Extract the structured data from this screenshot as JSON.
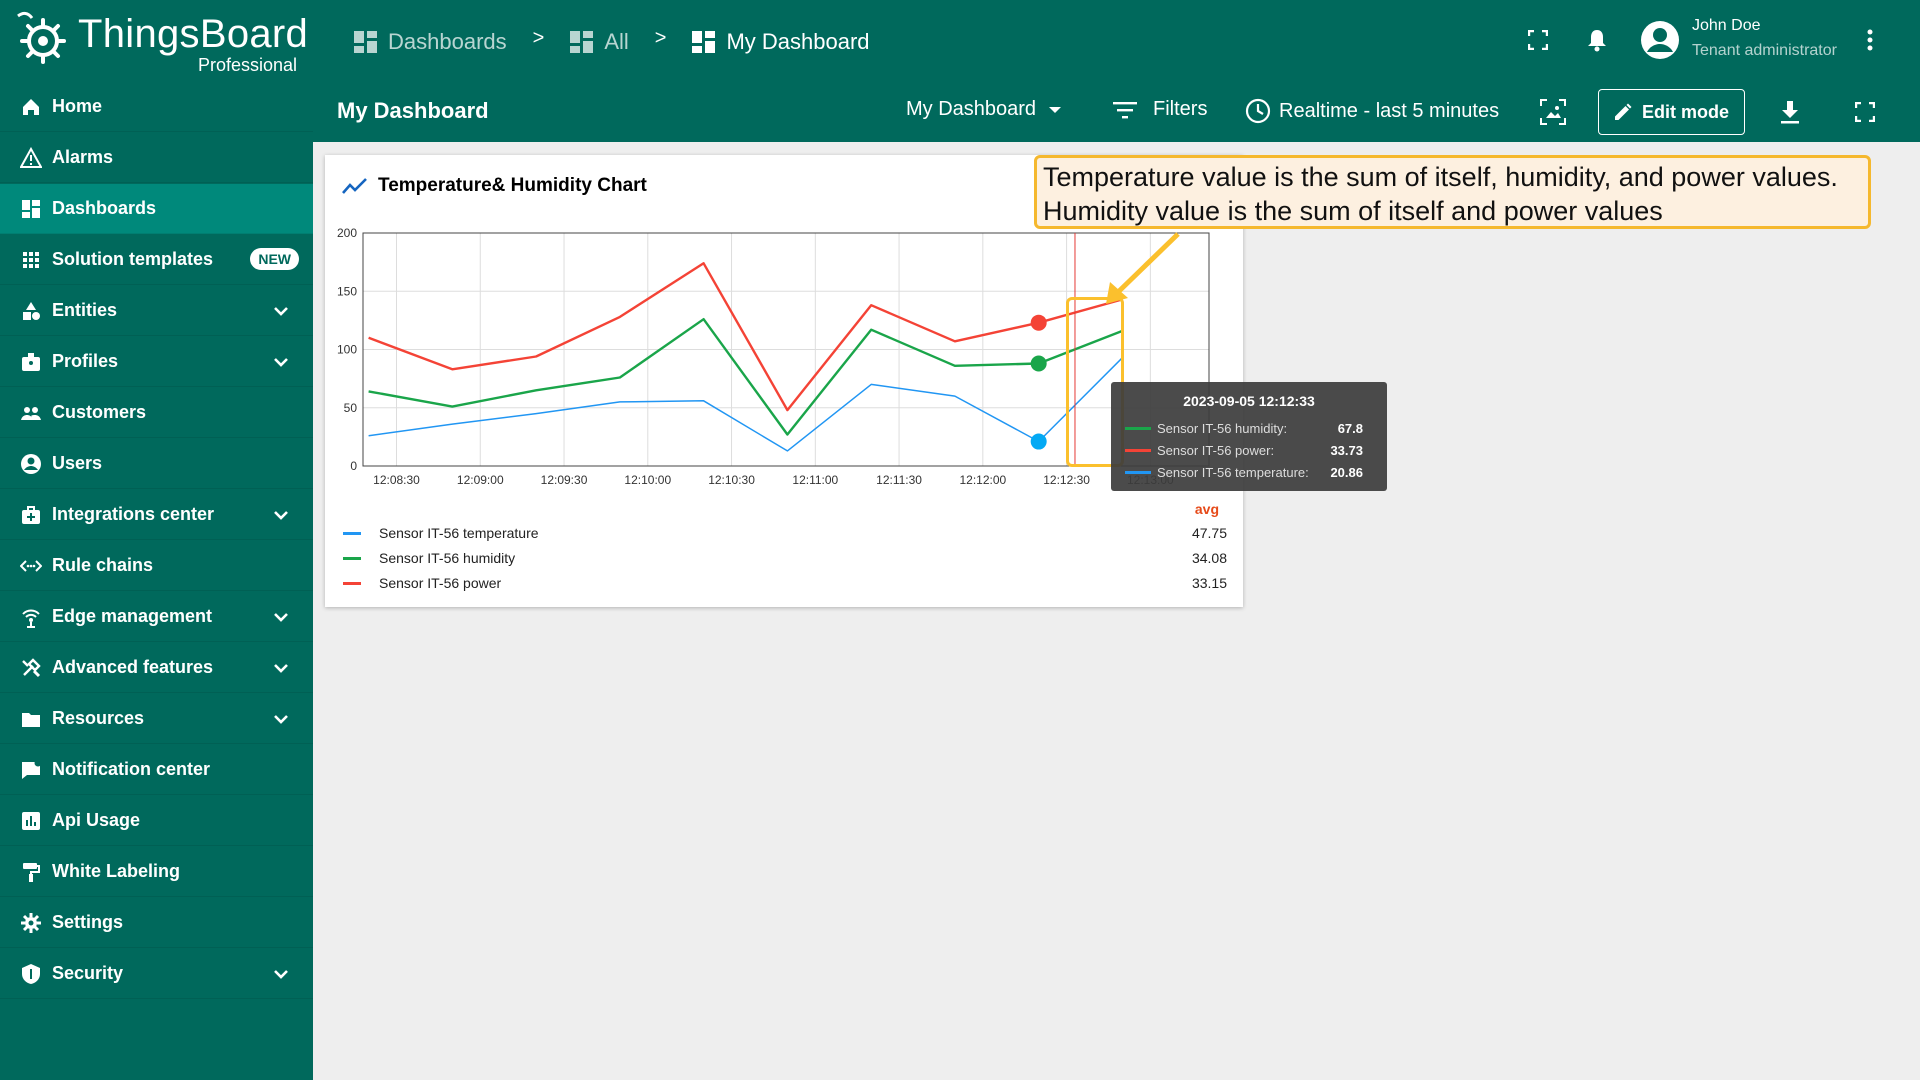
{
  "brand": {
    "name": "ThingsBoard",
    "edition": "Professional"
  },
  "breadcrumb": [
    {
      "label": "Dashboards",
      "icon": "dashboard-grid-icon"
    },
    {
      "label": "All",
      "icon": "dashboard-grid-icon"
    },
    {
      "label": "My Dashboard",
      "icon": "dashboard-grid-icon"
    }
  ],
  "breadcrumb_separator": ">",
  "user": {
    "name": "John Doe",
    "role": "Tenant administrator"
  },
  "sidebar": {
    "items": [
      {
        "label": "Home",
        "icon": "home-icon",
        "expandable": false
      },
      {
        "label": "Alarms",
        "icon": "warning-icon",
        "expandable": false
      },
      {
        "label": "Dashboards",
        "icon": "dashboard-icon",
        "expandable": false,
        "active": true
      },
      {
        "label": "Solution templates",
        "icon": "apps-icon",
        "expandable": false,
        "badge": "NEW"
      },
      {
        "label": "Entities",
        "icon": "category-icon",
        "expandable": true
      },
      {
        "label": "Profiles",
        "icon": "badge-icon",
        "expandable": true
      },
      {
        "label": "Customers",
        "icon": "people-icon",
        "expandable": false
      },
      {
        "label": "Users",
        "icon": "account-icon",
        "expandable": false
      },
      {
        "label": "Integrations center",
        "icon": "integration-icon",
        "expandable": true
      },
      {
        "label": "Rule chains",
        "icon": "settings-ethernet-icon",
        "expandable": false
      },
      {
        "label": "Edge management",
        "icon": "router-icon",
        "expandable": true
      },
      {
        "label": "Advanced features",
        "icon": "build-icon",
        "expandable": true
      },
      {
        "label": "Resources",
        "icon": "folder-icon",
        "expandable": true
      },
      {
        "label": "Notification center",
        "icon": "mark-chat-icon",
        "expandable": false
      },
      {
        "label": "Api Usage",
        "icon": "insert-chart-icon",
        "expandable": false
      },
      {
        "label": "White Labeling",
        "icon": "format-paint-icon",
        "expandable": false
      },
      {
        "label": "Settings",
        "icon": "gear-icon",
        "expandable": false
      },
      {
        "label": "Security",
        "icon": "shield-icon",
        "expandable": true
      }
    ]
  },
  "toolbar": {
    "title": "My Dashboard",
    "dashboard_select": "My Dashboard",
    "filters_label": "Filters",
    "timewindow_label": "Realtime - last 5 minutes",
    "edit_label": "Edit mode"
  },
  "widget": {
    "title": "Temperature& Humidity Chart",
    "legend_header": "avg",
    "legend": [
      {
        "name": "Sensor IT-56 temperature",
        "value": "47.75",
        "color": "#2196f3"
      },
      {
        "name": "Sensor IT-56 humidity",
        "value": "34.08",
        "color": "#1aa54a"
      },
      {
        "name": "Sensor IT-56 power",
        "value": "33.15",
        "color": "#f44336"
      }
    ]
  },
  "chart_data": {
    "type": "line",
    "stacked": true,
    "ylim": [
      0,
      200
    ],
    "yticks": [
      "0",
      "50",
      "100",
      "150",
      "200"
    ],
    "xticks": [
      "12:08:30",
      "12:09:00",
      "12:09:30",
      "12:10:00",
      "12:10:30",
      "12:11:00",
      "12:11:30",
      "12:12:00",
      "12:12:30",
      "12:13:00"
    ],
    "x": [
      "12:08:20",
      "12:08:50",
      "12:09:20",
      "12:09:50",
      "12:10:20",
      "12:10:50",
      "12:11:20",
      "12:11:50",
      "12:12:20",
      "12:12:50"
    ],
    "series": [
      {
        "name": "Sensor IT-56 power",
        "color": "#f44336",
        "values": [
          110,
          83,
          94,
          128,
          174,
          48,
          138,
          107,
          123,
          143
        ]
      },
      {
        "name": "Sensor IT-56 humidity",
        "color": "#1aa54a",
        "values": [
          64,
          51,
          65,
          76,
          126,
          27,
          117,
          86,
          88,
          116
        ]
      },
      {
        "name": "Sensor IT-56 temperature",
        "color": "#2196f3",
        "values": [
          26,
          36,
          45,
          55,
          56,
          13,
          70,
          60,
          21,
          93
        ]
      }
    ],
    "cursor_time": "12:12:33",
    "tooltip": {
      "time": "2023-09-05 12:12:33",
      "rows": [
        {
          "name": "Sensor IT-56 humidity:",
          "value": "67.8",
          "color": "#1aa54a"
        },
        {
          "name": "Sensor IT-56 power:",
          "value": "33.73",
          "color": "#f44336"
        },
        {
          "name": "Sensor IT-56 temperature:",
          "value": "20.86",
          "color": "#2196f3"
        }
      ]
    }
  },
  "annotation": {
    "line1": "Temperature value is the sum of itself, humidity, and power values.",
    "line2": "Humidity value is the sum of itself and power values"
  }
}
